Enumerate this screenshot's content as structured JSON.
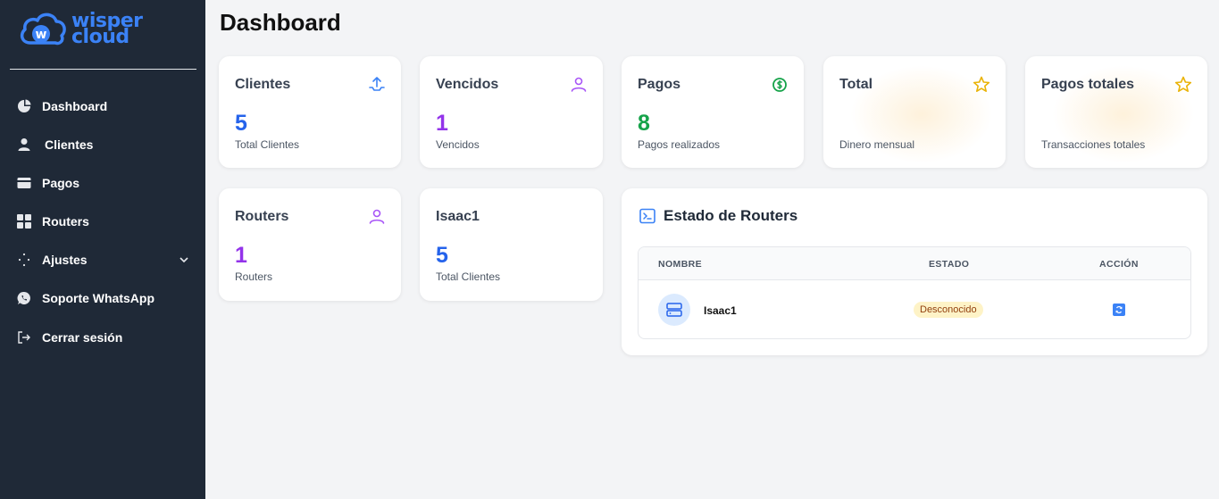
{
  "brand": {
    "line1": "wisper",
    "line2": "cloud",
    "color": "#3b82f6"
  },
  "sidebar": {
    "items": [
      {
        "label": "Dashboard",
        "icon": "pie-chart-icon"
      },
      {
        "label": "Clientes",
        "icon": "user-icon"
      },
      {
        "label": "Pagos",
        "icon": "credit-card-icon"
      },
      {
        "label": "Routers",
        "icon": "grid-icon"
      },
      {
        "label": "Ajustes",
        "icon": "settings-icon"
      },
      {
        "label": "Soporte WhatsApp",
        "icon": "whatsapp-icon"
      },
      {
        "label": "Cerrar sesión",
        "icon": "logout-icon"
      }
    ]
  },
  "page": {
    "title": "Dashboard"
  },
  "cards": {
    "clientes": {
      "title": "Clientes",
      "value": "5",
      "sub": "Total Clientes",
      "icon": "upload-share-icon",
      "color": "#2563eb"
    },
    "vencidos": {
      "title": "Vencidos",
      "value": "1",
      "sub": "Vencidos",
      "icon": "user-outline-icon",
      "color": "#9333ea"
    },
    "pagos": {
      "title": "Pagos",
      "value": "8",
      "sub": "Pagos realizados",
      "icon": "dollar-circle-icon",
      "color": "#16a34a"
    },
    "total": {
      "title": "Total",
      "sub": "Dinero mensual",
      "icon": "star-icon"
    },
    "pagos_totales": {
      "title": "Pagos totales",
      "sub": "Transacciones totales",
      "icon": "star-icon"
    },
    "routers": {
      "title": "Routers",
      "value": "1",
      "sub": "Routers",
      "icon": "user-outline-icon",
      "color": "#9333ea"
    },
    "isaac1": {
      "title": "Isaac1",
      "value": "5",
      "sub": "Total Clientes",
      "color": "#2563eb"
    }
  },
  "routers_panel": {
    "title": "Estado de Routers",
    "columns": [
      "NOMBRE",
      "ESTADO",
      "ACCIÓN"
    ],
    "rows": [
      {
        "name": "Isaac1",
        "status": "Desconocido"
      }
    ]
  }
}
